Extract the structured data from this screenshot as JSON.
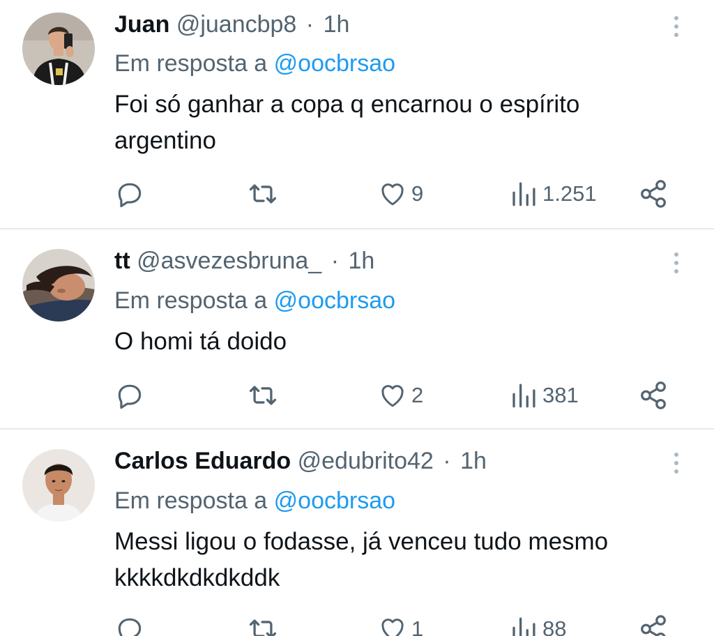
{
  "tweets": [
    {
      "name": "Juan",
      "handle": "@juancbp8",
      "separator": "·",
      "time": "1h",
      "reply_prefix": "Em resposta a",
      "reply_to": "@oocbrsao",
      "text": "Foi só ganhar a copa q encarnou o espírito argentino",
      "likes": "9",
      "views": "1.251",
      "avatar_colors": {
        "bg": "#c9c2b8",
        "shirt": "#1b1b1b",
        "skin": "#d9a98a",
        "hair": "#3a2a1e"
      }
    },
    {
      "name": "tt",
      "handle": "@asvezesbruna_",
      "separator": "·",
      "time": "1h",
      "reply_prefix": "Em resposta a",
      "reply_to": "@oocbrsao",
      "text": "O homi tá doido",
      "likes": "2",
      "views": "381",
      "avatar_colors": {
        "bg": "#d8d2cc",
        "shirt": "#2b3a55",
        "skin": "#c98e6e",
        "hair": "#2a1d18"
      }
    },
    {
      "name": "Carlos Eduardo",
      "handle": "@edubrito42",
      "separator": "·",
      "time": "1h",
      "reply_prefix": "Em resposta a",
      "reply_to": "@oocbrsao",
      "text": "Messi ligou o fodasse, já venceu tudo mesmo kkkkdkdkdkddk",
      "likes": "1",
      "views": "88",
      "avatar_colors": {
        "bg": "#ebe6e1",
        "shirt": "#f4f4f4",
        "skin": "#c68a66",
        "hair": "#1d1712"
      }
    }
  ],
  "colors": {
    "text": "#0f1419",
    "secondary": "#536471",
    "link": "#1d9bf0",
    "divider": "#e6e9ec"
  },
  "icons": {
    "reply": "reply-icon",
    "retweet": "retweet-icon",
    "like": "like-icon",
    "views": "views-icon",
    "share": "share-icon",
    "more": "more-icon"
  }
}
